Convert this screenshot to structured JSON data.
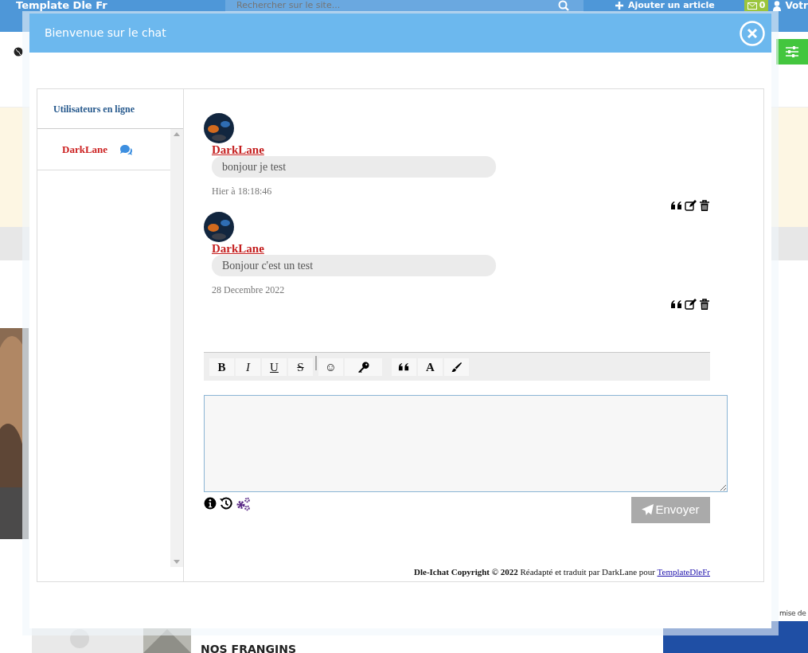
{
  "background_page": {
    "site_title": "Template Dle Fr",
    "search": {
      "placeholder": "Rechercher sur le site..."
    },
    "add_button": "Ajouter un article",
    "messages_count": "0",
    "account": "Votr",
    "side_text": "mise de",
    "article_title": "NOS FRANGINS"
  },
  "chat_window": {
    "title": "Bienvenue sur le chat",
    "online_header": "Utilisateurs en ligne",
    "online_users": [
      {
        "name": "DarkLane"
      }
    ],
    "messages": [
      {
        "author": "DarkLane",
        "text": "bonjour je test",
        "time": "Hier à 18:18:46"
      },
      {
        "author": "DarkLane",
        "text": "Bonjour c'est un test",
        "time": "28 Decembre 2022"
      }
    ],
    "toolbar": [
      {
        "kind": "bold",
        "label": "B"
      },
      {
        "kind": "italic",
        "label": "I"
      },
      {
        "kind": "underline",
        "label": "U"
      },
      {
        "kind": "strike",
        "label": "S"
      },
      {
        "kind": "separator"
      },
      {
        "kind": "smiley",
        "label": "☺"
      },
      {
        "kind": "key"
      },
      {
        "kind": "gap"
      },
      {
        "kind": "quote"
      },
      {
        "kind": "color",
        "label": "A"
      },
      {
        "kind": "brush"
      }
    ],
    "send_button": "Envoyer",
    "footer": {
      "text": "**Dle-Ichat Copyright © 2022** Réadapté et traduit par DarkLane pour",
      "link": "TemplateDleFr"
    }
  }
}
